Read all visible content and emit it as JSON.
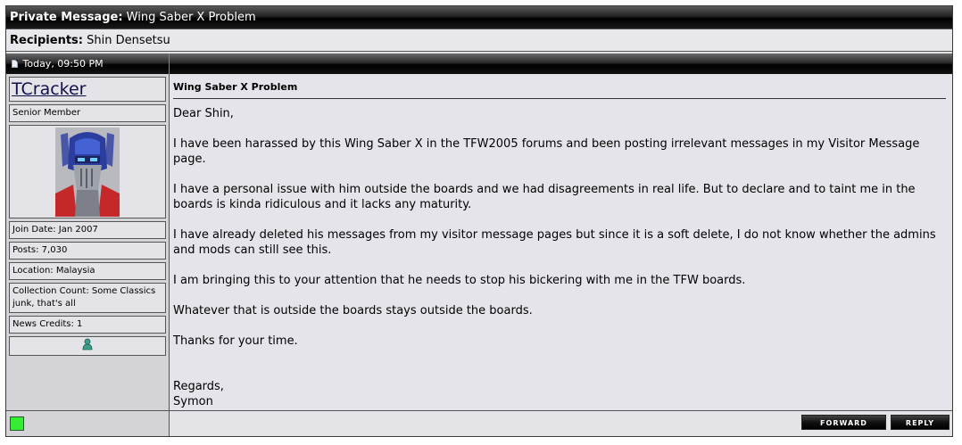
{
  "header": {
    "title_label": "Private Message:",
    "title_value": "Wing Saber X Problem"
  },
  "recipients": {
    "label": "Recipients:",
    "value": "Shin Densetsu"
  },
  "post": {
    "date": "Today, 09:50 PM"
  },
  "author": {
    "username": "TCracker",
    "rank": "Senior Member",
    "join_date": "Join Date: Jan 2007",
    "posts": "Posts: 7,030",
    "location": "Location: Malaysia",
    "collection": "Collection Count: Some Classics junk, that's all",
    "news_credits": "News Credits: 1",
    "avatar_icon": "optimus-prime-avatar",
    "profile_icon": "user-icon",
    "online_status_color": "#33ee33"
  },
  "message": {
    "title": "Wing Saber X Problem",
    "paragraphs": [
      "Dear Shin,",
      "I have been harassed by this Wing Saber X in the TFW2005 forums and been posting irrelevant messages in my Visitor Message page.",
      "I have a personal issue with him outside the boards and we had disagreements in real life. But to declare and to taint me in the boards is kinda ridiculous and it lacks any maturity.",
      "I have already deleted his messages from my visitor message pages but since it is a soft delete, I do not know whether the admins and mods can still see this.",
      "I am bringing this to your attention that he needs to stop his bickering with me in the TFW boards.",
      "Whatever that is outside the boards stays outside the boards.",
      "Thanks for your time."
    ],
    "closing": "Regards,",
    "signature": "Symon"
  },
  "buttons": {
    "forward": "FORWARD",
    "reply": "REPLY"
  }
}
